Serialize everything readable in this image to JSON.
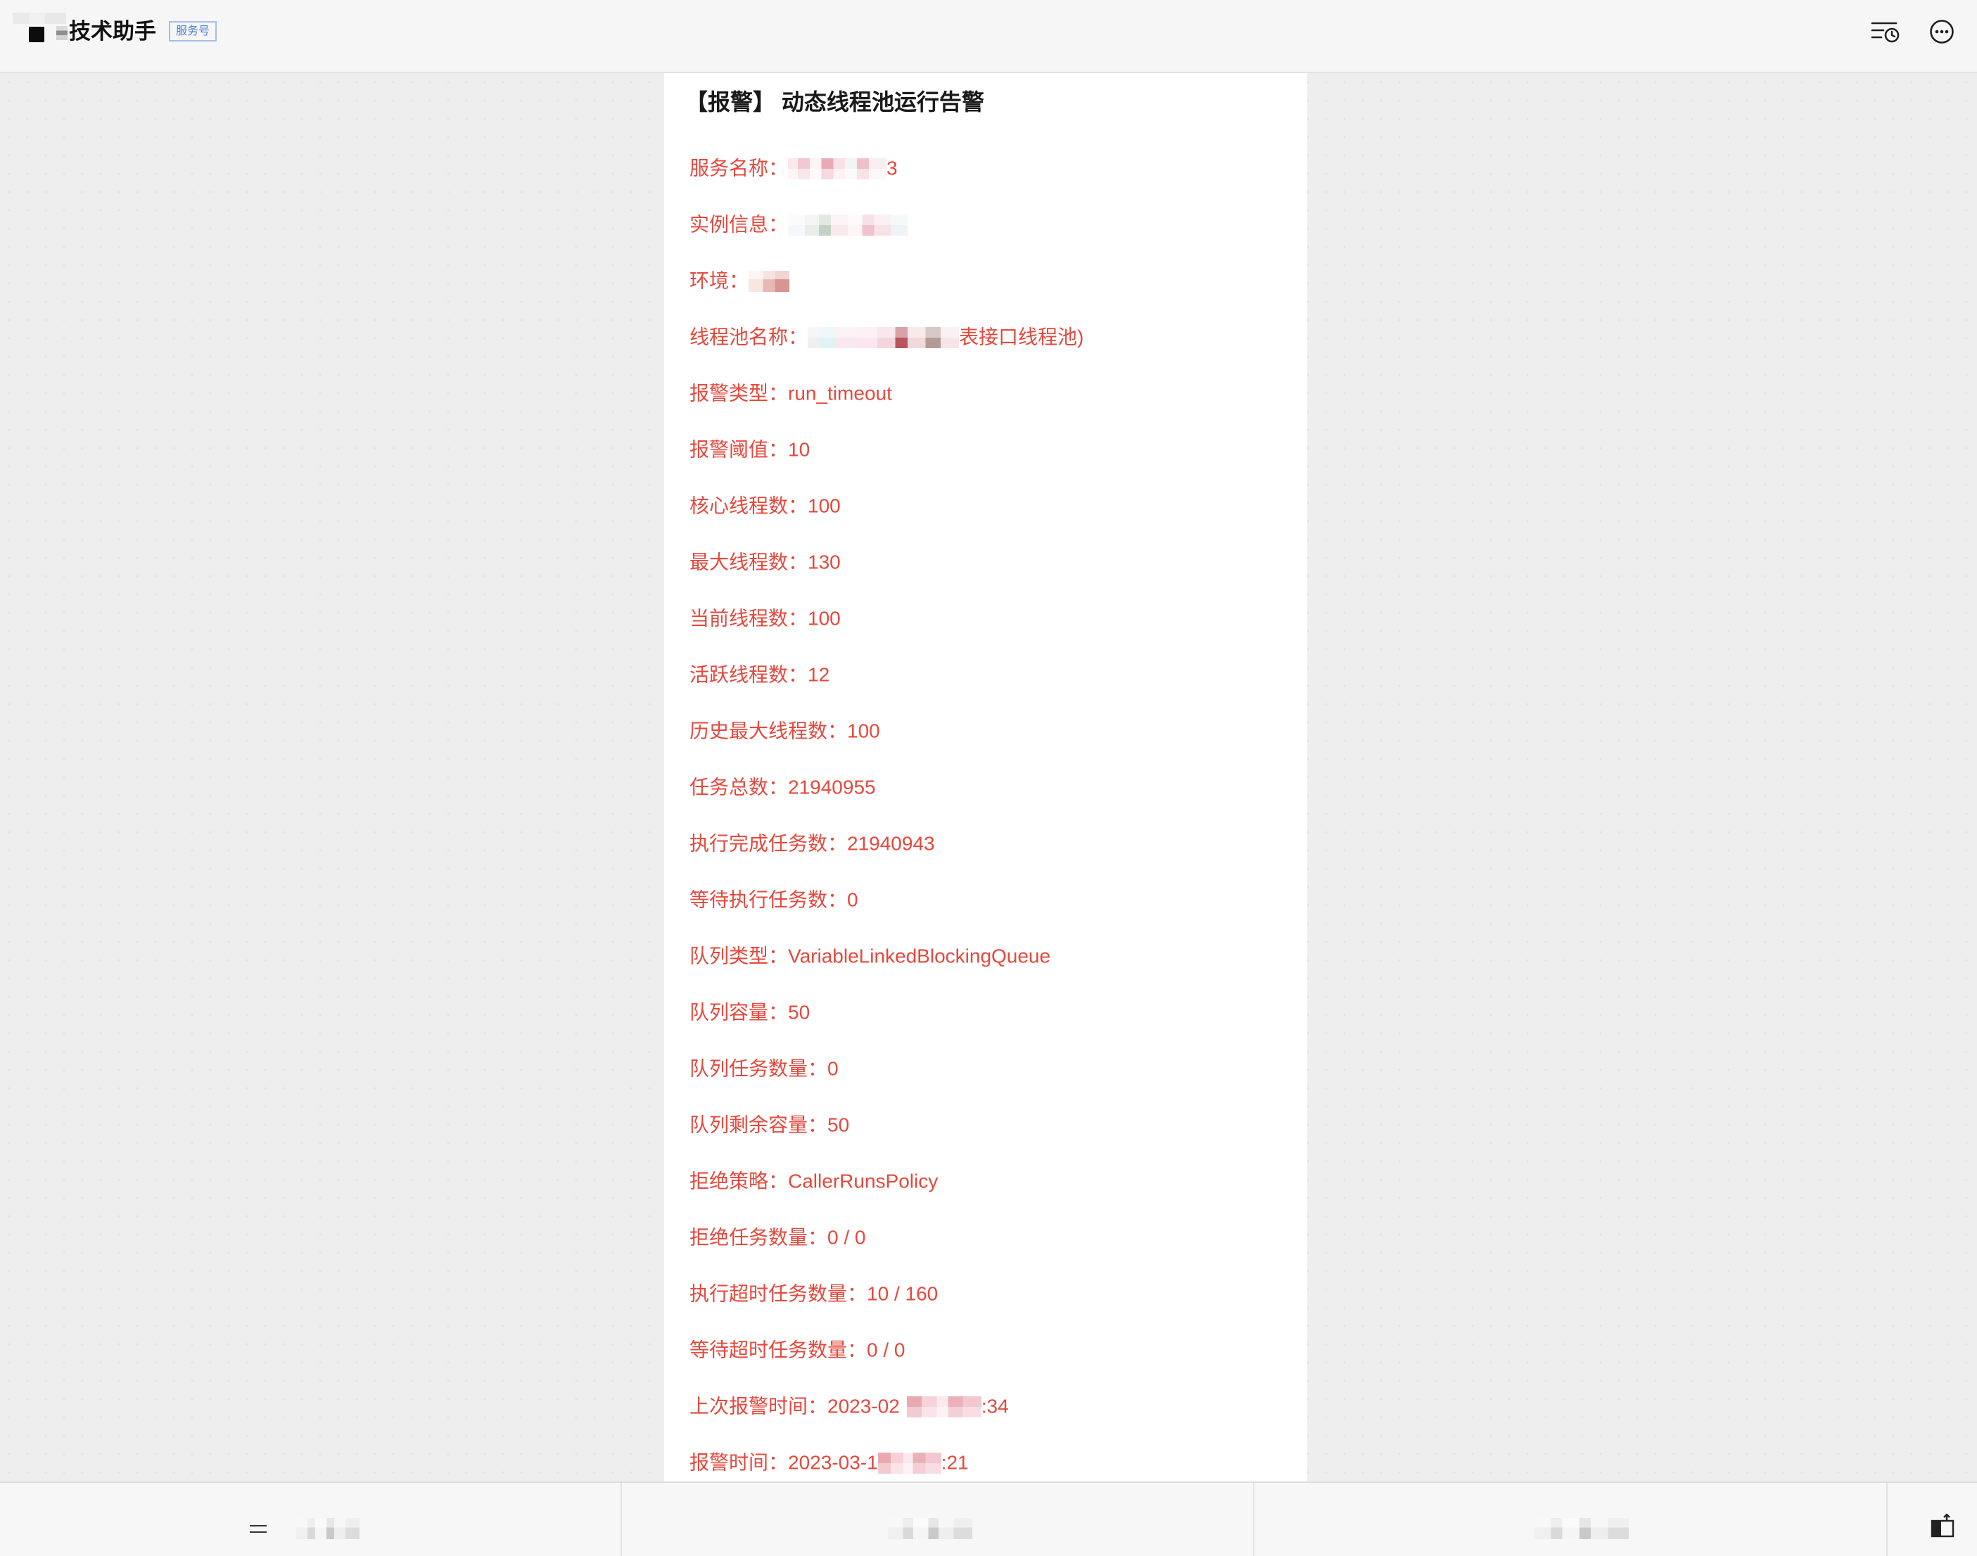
{
  "header": {
    "title": "技术助手",
    "badge": "服务号",
    "icons": {
      "avatar": "account-avatar-icon",
      "history": "history-icon",
      "more": "more-icon"
    }
  },
  "message": {
    "title": "【报警】 动态线程池运行告警",
    "fields": [
      {
        "label": "服务名称：",
        "suffix": "3",
        "redacted": true
      },
      {
        "label": "实例信息：",
        "redacted": true
      },
      {
        "label": "环境：",
        "redacted": true
      },
      {
        "label": "线程池名称：",
        "suffix": "表接口线程池)",
        "redacted": true
      },
      {
        "label": "报警类型：",
        "value": "run_timeout"
      },
      {
        "label": "报警阈值：",
        "value": "10"
      },
      {
        "label": "核心线程数：",
        "value": "100"
      },
      {
        "label": "最大线程数：",
        "value": "130"
      },
      {
        "label": "当前线程数：",
        "value": "100"
      },
      {
        "label": "活跃线程数：",
        "value": "12"
      },
      {
        "label": "历史最大线程数：",
        "value": "100"
      },
      {
        "label": "任务总数：",
        "value": "21940955"
      },
      {
        "label": "执行完成任务数：",
        "value": "21940943"
      },
      {
        "label": "等待执行任务数：",
        "value": "0"
      },
      {
        "label": "队列类型：",
        "value": "VariableLinkedBlockingQueue"
      },
      {
        "label": "队列容量：",
        "value": "50"
      },
      {
        "label": "队列任务数量：",
        "value": "0"
      },
      {
        "label": "队列剩余容量：",
        "value": "50"
      },
      {
        "label": "拒绝策略：",
        "value": "CallerRunsPolicy"
      },
      {
        "label": "拒绝任务数量：",
        "value": "0 / 0"
      },
      {
        "label": "执行超时任务数量：",
        "value": "10 / 160"
      },
      {
        "label": "等待超时任务数量：",
        "value": "0 / 0"
      },
      {
        "label": "上次报警时间：",
        "value": "2023-02",
        "suffix": ":34",
        "redacted": true
      },
      {
        "label": "报警时间：",
        "value": "2023-03-1",
        "suffix": ":21",
        "redacted": true
      }
    ]
  },
  "bottom_menu": {
    "menu_icon": "menu-icon",
    "switch_icon": "keyboard-switch-icon",
    "labels_redacted": true
  },
  "colors": {
    "alert_text": "#e5483d",
    "title_text": "#191919",
    "badge_blue": "#4a7fd6"
  }
}
